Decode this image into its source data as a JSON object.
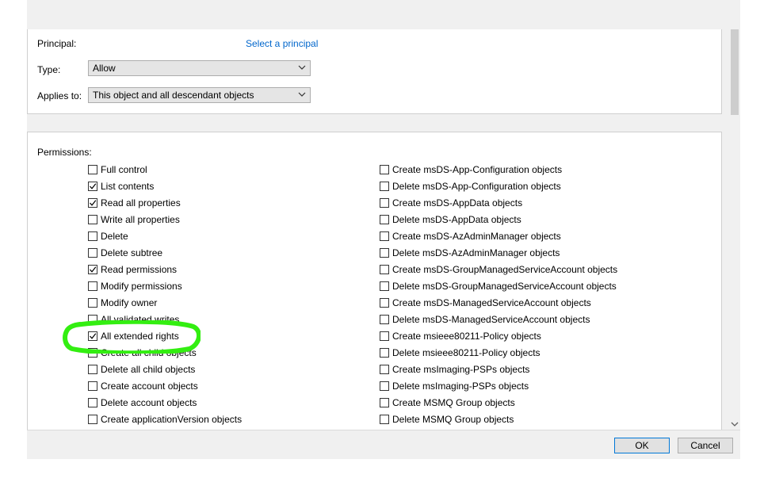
{
  "principal": {
    "label": "Principal:",
    "link": "Select a principal"
  },
  "type": {
    "label": "Type:",
    "value": "Allow"
  },
  "applies_to": {
    "label": "Applies to:",
    "value": "This object and all descendant objects"
  },
  "permissions": {
    "label": "Permissions:",
    "left": [
      {
        "label": "Full control",
        "checked": false
      },
      {
        "label": "List contents",
        "checked": true
      },
      {
        "label": "Read all properties",
        "checked": true
      },
      {
        "label": "Write all properties",
        "checked": false
      },
      {
        "label": "Delete",
        "checked": false
      },
      {
        "label": "Delete subtree",
        "checked": false
      },
      {
        "label": "Read permissions",
        "checked": true
      },
      {
        "label": "Modify permissions",
        "checked": false
      },
      {
        "label": "Modify owner",
        "checked": false
      },
      {
        "label": "All validated writes",
        "checked": false
      },
      {
        "label": "All extended rights",
        "checked": true
      },
      {
        "label": "Create all child objects",
        "checked": false
      },
      {
        "label": "Delete all child objects",
        "checked": false
      },
      {
        "label": "Create account objects",
        "checked": false
      },
      {
        "label": "Delete account objects",
        "checked": false
      },
      {
        "label": "Create applicationVersion objects",
        "checked": false
      }
    ],
    "right": [
      {
        "label": "Create msDS-App-Configuration objects",
        "checked": false
      },
      {
        "label": "Delete msDS-App-Configuration objects",
        "checked": false
      },
      {
        "label": "Create msDS-AppData objects",
        "checked": false
      },
      {
        "label": "Delete msDS-AppData objects",
        "checked": false
      },
      {
        "label": "Create msDS-AzAdminManager objects",
        "checked": false
      },
      {
        "label": "Delete msDS-AzAdminManager objects",
        "checked": false
      },
      {
        "label": "Create msDS-GroupManagedServiceAccount objects",
        "checked": false
      },
      {
        "label": "Delete msDS-GroupManagedServiceAccount objects",
        "checked": false
      },
      {
        "label": "Create msDS-ManagedServiceAccount objects",
        "checked": false
      },
      {
        "label": "Delete msDS-ManagedServiceAccount objects",
        "checked": false
      },
      {
        "label": "Create msieee80211-Policy objects",
        "checked": false
      },
      {
        "label": "Delete msieee80211-Policy objects",
        "checked": false
      },
      {
        "label": "Create msImaging-PSPs objects",
        "checked": false
      },
      {
        "label": "Delete msImaging-PSPs objects",
        "checked": false
      },
      {
        "label": "Create MSMQ Group objects",
        "checked": false
      },
      {
        "label": "Delete MSMQ Group objects",
        "checked": false
      }
    ]
  },
  "buttons": {
    "ok": "OK",
    "cancel": "Cancel"
  },
  "icons": {
    "dropdown": "chevron-down-icon",
    "check": "checkmark-icon",
    "scroll_down": "scroll-down-arrow-icon"
  },
  "colors": {
    "link": "#0066cc",
    "highlight": "#33ee11",
    "ok_border": "#0078d7"
  }
}
